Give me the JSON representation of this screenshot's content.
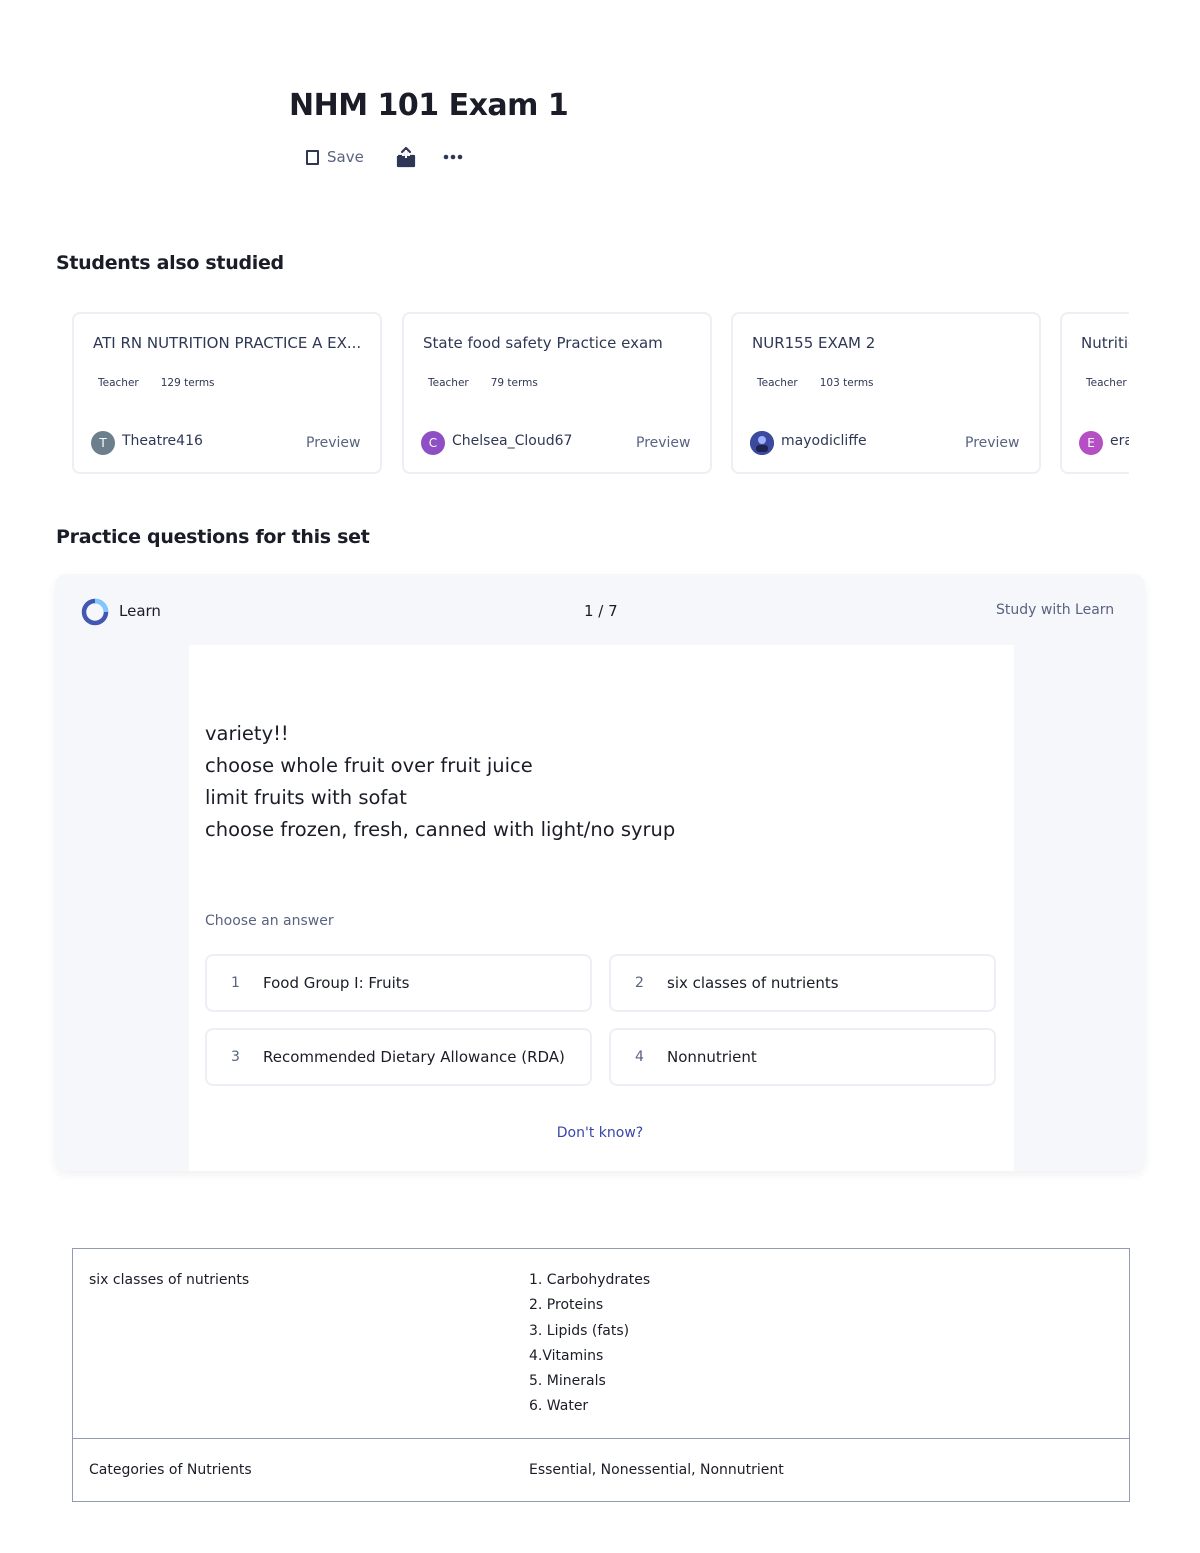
{
  "header": {
    "title": "NHM 101 Exam 1",
    "save_label": "Save",
    "share_icon": "share-icon",
    "more_icon": "more-icon"
  },
  "students_also_studied": {
    "heading": "Students also studied",
    "cards": [
      {
        "title": "ATI RN NUTRITION PRACTICE A EX...",
        "role": "Teacher",
        "terms": "129 terms",
        "avatar_letter": "T",
        "avatar_color": "#6b7f8c",
        "user": "Theatre416",
        "preview": "Preview"
      },
      {
        "title": "State food safety Practice exam",
        "role": "Teacher",
        "terms": "79 terms",
        "avatar_letter": "C",
        "avatar_color": "#8e4fc4",
        "user": "Chelsea_Cloud67",
        "preview": "Preview"
      },
      {
        "title": "NUR155 EXAM 2",
        "role": "Teacher",
        "terms": "103 terms",
        "avatar_letter": "",
        "avatar_color": "#3b4a9c",
        "user": "mayodicliffe",
        "preview": "Preview"
      },
      {
        "title": "Nutrition",
        "role": "Teacher",
        "terms": "",
        "avatar_letter": "E",
        "avatar_color": "#b44fc4",
        "user": "era",
        "preview": ""
      }
    ]
  },
  "practice": {
    "heading": "Practice questions for this set",
    "learn_label": "Learn",
    "counter": "1 / 7",
    "study_link": "Study with Learn",
    "question_lines": [
      "variety!!",
      "choose whole fruit over fruit juice",
      "limit fruits with sofat",
      "choose frozen, fresh, canned with light/no syrup"
    ],
    "choose_label": "Choose an answer",
    "options": [
      {
        "num": "1",
        "text": "Food Group I: Fruits"
      },
      {
        "num": "2",
        "text": "six classes of nutrients"
      },
      {
        "num": "3",
        "text": "Recommended Dietary Allowance (RDA)"
      },
      {
        "num": "4",
        "text": "Nonnutrient"
      }
    ],
    "dont_know": "Don't know?"
  },
  "terms": [
    {
      "term": "six classes of nutrients",
      "definition_lines": [
        "1. Carbohydrates",
        "2. Proteins",
        "3. Lipids (fats)",
        "4.Vitamins",
        "5. Minerals",
        "6. Water"
      ]
    },
    {
      "term": "Categories of Nutrients",
      "definition_lines": [
        "Essential, Nonessential, Nonnutrient"
      ]
    }
  ],
  "colors": {
    "title": "#1a1d28",
    "text": "#2e3856",
    "muted": "#586380",
    "link": "#3a47a8",
    "border": "#edeff4",
    "table_border": "#939bb4"
  }
}
